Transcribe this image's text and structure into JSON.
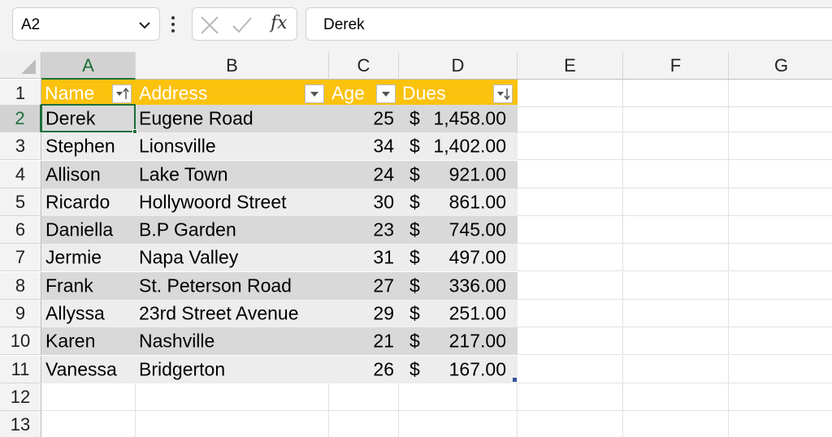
{
  "formula_bar": {
    "name_box": "A2",
    "fx_label": "fx",
    "formula_value": "Derek"
  },
  "columns": [
    "A",
    "B",
    "C",
    "D",
    "E",
    "F",
    "G"
  ],
  "rows": [
    "1",
    "2",
    "3",
    "4",
    "5",
    "6",
    "7",
    "8",
    "9",
    "10",
    "11",
    "12",
    "13"
  ],
  "table": {
    "headers": {
      "name": "Name",
      "address": "Address",
      "age": "Age",
      "dues": "Dues"
    },
    "records": [
      {
        "name": "Derek",
        "address": "Eugene Road",
        "age": "25",
        "currency": "$",
        "dues": "1,458.00"
      },
      {
        "name": "Stephen",
        "address": "Lionsville",
        "age": "34",
        "currency": "$",
        "dues": "1,402.00"
      },
      {
        "name": "Allison",
        "address": "Lake Town",
        "age": "24",
        "currency": "$",
        "dues": "921.00"
      },
      {
        "name": "Ricardo",
        "address": "Hollywoord Street",
        "age": "30",
        "currency": "$",
        "dues": "861.00"
      },
      {
        "name": "Daniella",
        "address": "B.P Garden",
        "age": "23",
        "currency": "$",
        "dues": "745.00"
      },
      {
        "name": "Jermie",
        "address": "Napa Valley",
        "age": "31",
        "currency": "$",
        "dues": "497.00"
      },
      {
        "name": "Frank",
        "address": "St. Peterson Road",
        "age": "27",
        "currency": "$",
        "dues": "336.00"
      },
      {
        "name": "Allyssa",
        "address": "23rd Street Avenue",
        "age": "29",
        "currency": "$",
        "dues": "251.00"
      },
      {
        "name": "Karen",
        "address": "Nashville",
        "age": "21",
        "currency": "$",
        "dues": "217.00"
      },
      {
        "name": "Vanessa",
        "address": "Bridgerton",
        "age": "26",
        "currency": "$",
        "dues": "167.00"
      }
    ]
  },
  "colors": {
    "header_fill": "#fbc20e",
    "band_dark": "#d9d9d9",
    "band_light": "#ededed",
    "selection": "#1e6e3c"
  },
  "icons": {
    "name_box_dropdown": "chevron-down-icon",
    "more": "vertical-dots-icon",
    "cancel": "x-icon",
    "enter": "check-icon",
    "insert_function": "fx-icon",
    "sort_name": "sort-ascending-filter-icon",
    "sort_dues": "sort-descending-filter-icon",
    "filter": "filter-dropdown-icon"
  }
}
